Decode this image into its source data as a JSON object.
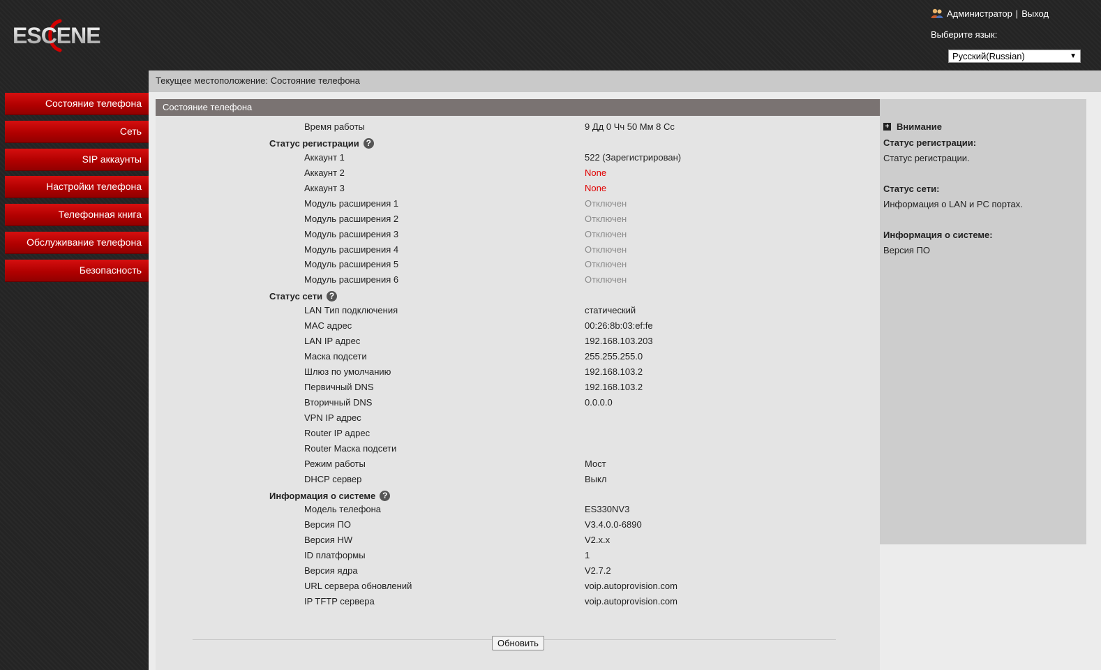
{
  "header": {
    "logo_text": "ESCENE",
    "user_label": "Администратор",
    "separator": "|",
    "logout_label": "Выход",
    "lang_label": "Выберите язык:",
    "lang_selected": "Русский(Russian)"
  },
  "sidebar": {
    "items": [
      {
        "label": "Состояние телефона"
      },
      {
        "label": "Сеть"
      },
      {
        "label": "SIP аккаунты"
      },
      {
        "label": "Настройки телефона"
      },
      {
        "label": "Телефонная книга"
      },
      {
        "label": "Обслуживание телефона"
      },
      {
        "label": "Безопасность"
      }
    ]
  },
  "main": {
    "breadcrumb": "Текущее местоположение: Состояние телефона",
    "section_title": "Состояние телефона",
    "uptime": {
      "label": "Время работы",
      "value": "9 Дд 0 Чч 50 Мм 8 Сс"
    },
    "registration": {
      "title": "Статус регистрации",
      "rows": [
        {
          "label": "Аккаунт 1",
          "value": "522 (Зарегистрирован)"
        },
        {
          "label": "Аккаунт 2",
          "value": "None"
        },
        {
          "label": "Аккаунт 3",
          "value": "None"
        },
        {
          "label": "Модуль расширения 1",
          "value": "Отключен"
        },
        {
          "label": "Модуль расширения 2",
          "value": "Отключен"
        },
        {
          "label": "Модуль расширения 3",
          "value": "Отключен"
        },
        {
          "label": "Модуль расширения 4",
          "value": "Отключен"
        },
        {
          "label": "Модуль расширения 5",
          "value": "Отключен"
        },
        {
          "label": "Модуль расширения 6",
          "value": "Отключен"
        }
      ]
    },
    "network": {
      "title": "Статус сети",
      "rows": [
        {
          "label": "LAN Тип подключения",
          "value": "статический"
        },
        {
          "label": "MAC адрес",
          "value": "00:26:8b:03:ef:fe"
        },
        {
          "label": "LAN IP адрес",
          "value": "192.168.103.203"
        },
        {
          "label": "Маска подсети",
          "value": "255.255.255.0"
        },
        {
          "label": "Шлюз по умолчанию",
          "value": "192.168.103.2"
        },
        {
          "label": "Первичный DNS",
          "value": "192.168.103.2"
        },
        {
          "label": "Вторичный DNS",
          "value": "0.0.0.0"
        },
        {
          "label": "VPN IP адрес",
          "value": ""
        },
        {
          "label": "Router IP адрес",
          "value": ""
        },
        {
          "label": "Router Маска подсети",
          "value": ""
        },
        {
          "label": "Режим работы",
          "value": "Мост"
        },
        {
          "label": "DHCP сервер",
          "value": "Выкл"
        }
      ]
    },
    "system": {
      "title": "Информация о системе",
      "rows": [
        {
          "label": "Модель телефона",
          "value": "ES330NV3"
        },
        {
          "label": "Версия ПО",
          "value": "V3.4.0.0-6890"
        },
        {
          "label": "Версия HW",
          "value": "V2.x.x"
        },
        {
          "label": "ID платформы",
          "value": "1"
        },
        {
          "label": "Версия ядра",
          "value": "V2.7.2"
        },
        {
          "label": "URL сервера обновлений",
          "value": "voip.autoprovision.com"
        },
        {
          "label": "IP TFTP сервера",
          "value": "voip.autoprovision.com"
        }
      ]
    },
    "refresh_label": "Обновить"
  },
  "attention": {
    "title": "Внимание",
    "items": [
      {
        "heading": "Статус регистрации:",
        "text": "Статус регистрации."
      },
      {
        "heading": "Статус сети:",
        "text": "Информация о LAN и PC портах."
      },
      {
        "heading": "Информация о системе:",
        "text": "Версия ПО"
      }
    ]
  },
  "colors": {
    "background": "#242424",
    "nav_red": "#c00000",
    "value_red": "#e00000",
    "value_grey": "#8a8a8a",
    "section_header": "#7a7372",
    "attention_bg": "#cdcdcd"
  }
}
